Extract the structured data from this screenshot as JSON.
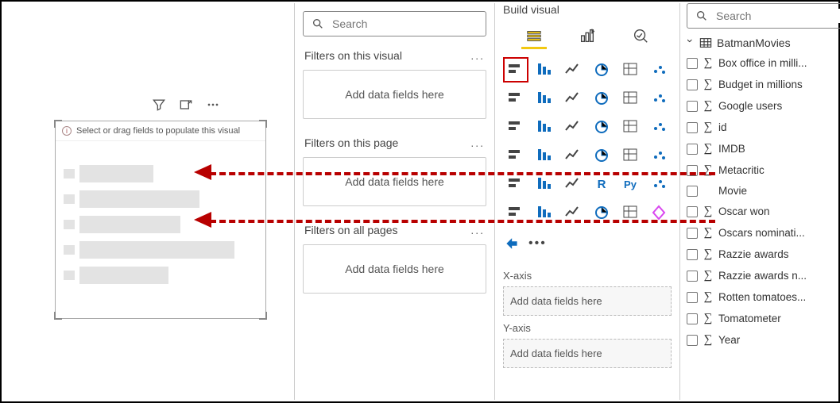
{
  "canvas": {
    "visual_hint": "Select or drag fields to populate this visual"
  },
  "filters": {
    "search_placeholder": "Search",
    "sections": [
      {
        "title": "Filters on this visual",
        "well": "Add data fields here"
      },
      {
        "title": "Filters on this page",
        "well": "Add data fields here"
      },
      {
        "title": "Filters on all pages",
        "well": "Add data fields here"
      }
    ]
  },
  "visual_pane": {
    "header": "Build visual",
    "tabs": [
      "build",
      "format",
      "analytics"
    ],
    "viz_types": [
      "stacked-bar",
      "clustered-bar",
      "stacked-bar-h",
      "clustered-column",
      "stacked-column-100",
      "stacked-bar-100",
      "line",
      "area",
      "stacked-area",
      "line-clustered",
      "line-stacked",
      "ribbon",
      "waterfall",
      "funnel",
      "scatter",
      "pie",
      "donut",
      "treemap",
      "map",
      "filled-map",
      "azure-map",
      "gauge",
      "card",
      "multi-card",
      "kpi",
      "table",
      "matrix",
      "r-visual",
      "py-visual",
      "key-influencers",
      "decomposition",
      "q-and-a",
      "smart-narrative",
      "paginated",
      "power-apps",
      "power-automate"
    ],
    "selected_viz_index": 0,
    "wells": {
      "xaxis_label": "X-axis",
      "xaxis_placeholder": "Add data fields here",
      "yaxis_label": "Y-axis",
      "yaxis_placeholder": "Add data fields here"
    }
  },
  "fields": {
    "search_placeholder": "Search",
    "table_name": "BatmanMovies",
    "columns": [
      {
        "name": "Box office in milli...",
        "is_measure": true
      },
      {
        "name": "Budget in millions",
        "is_measure": true
      },
      {
        "name": "Google users",
        "is_measure": true
      },
      {
        "name": "id",
        "is_measure": true
      },
      {
        "name": "IMDB",
        "is_measure": true
      },
      {
        "name": "Metacritic",
        "is_measure": true
      },
      {
        "name": "Movie",
        "is_measure": false
      },
      {
        "name": "Oscar won",
        "is_measure": true
      },
      {
        "name": "Oscars nominati...",
        "is_measure": true
      },
      {
        "name": "Razzie awards",
        "is_measure": true
      },
      {
        "name": "Razzie awards n...",
        "is_measure": true
      },
      {
        "name": "Rotten tomatoes...",
        "is_measure": true
      },
      {
        "name": "Tomatometer",
        "is_measure": true
      },
      {
        "name": "Year",
        "is_measure": true
      }
    ]
  }
}
